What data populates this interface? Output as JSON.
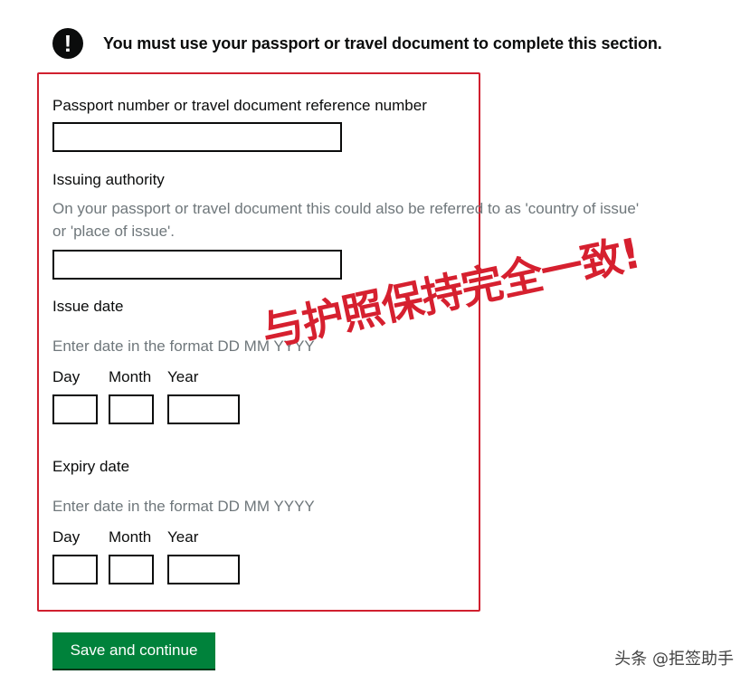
{
  "warning": {
    "icon": "exclamation-icon",
    "text": "You must use your passport or travel document to complete this section."
  },
  "passport": {
    "label": "Passport number or travel document reference number",
    "value": ""
  },
  "issuing_authority": {
    "label": "Issuing authority",
    "hint": "On your passport or travel document this could also be referred to as 'country of issue' or 'place of issue'.",
    "value": ""
  },
  "issue_date": {
    "label": "Issue date",
    "hint": "Enter date in the format DD MM YYYY",
    "day_label": "Day",
    "month_label": "Month",
    "year_label": "Year"
  },
  "expiry_date": {
    "label": "Expiry date",
    "hint": "Enter date in the format DD MM YYYY",
    "day_label": "Day",
    "month_label": "Month",
    "year_label": "Year"
  },
  "annotation": {
    "text": "与护照保持完全一致!",
    "color": "#d6202f"
  },
  "save_button": {
    "label": "Save and continue"
  },
  "watermark": {
    "text": "头条 @拒签助手"
  },
  "colors": {
    "button": "#00823b",
    "highlight_border": "#d0202f",
    "hint_text": "#6f777b"
  }
}
